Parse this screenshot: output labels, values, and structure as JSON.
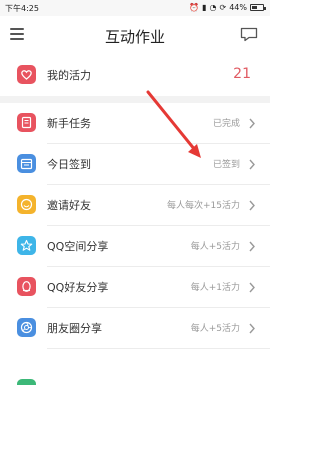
{
  "statusbar": {
    "time": "下午4:25",
    "battery": "44%",
    "battery_level": 0.44
  },
  "header": {
    "title": "互动作业",
    "menu_icon": "hamburger-menu-icon",
    "chat_icon": "chat-bubble-icon"
  },
  "vitality": {
    "label": "我的活力",
    "value": "21",
    "icon": "heart-icon",
    "color": "#e8535f"
  },
  "tasks": [
    {
      "label": "新手任务",
      "status": "已完成",
      "icon": "document-icon",
      "color": "#e8535f"
    },
    {
      "label": "今日签到",
      "status": "已签到",
      "icon": "calendar-icon",
      "color": "#4a8fe0"
    },
    {
      "label": "邀请好友",
      "status": "每人每次+15活力",
      "icon": "smiley-icon",
      "color": "#f4b32c"
    },
    {
      "label": "QQ空间分享",
      "status": "每人+5活力",
      "icon": "star-icon",
      "color": "#3eb5e8"
    },
    {
      "label": "QQ好友分享",
      "status": "每人+1活力",
      "icon": "penguin-icon",
      "color": "#e8535f"
    },
    {
      "label": "朋友圈分享",
      "status": "每人+5活力",
      "icon": "aperture-icon",
      "color": "#4a8fe0"
    }
  ],
  "colors": {
    "accent_red": "#e8535f",
    "arrow": "#e53935"
  }
}
